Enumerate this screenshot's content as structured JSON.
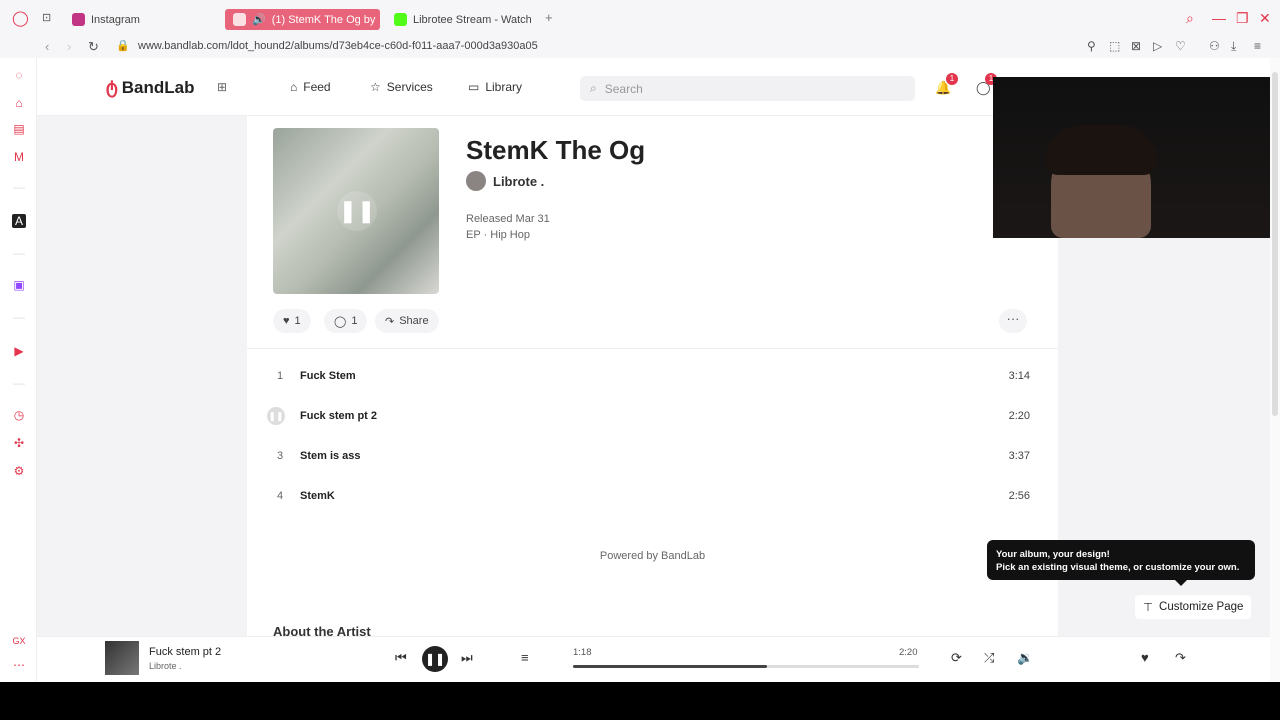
{
  "browser": {
    "tabs": [
      {
        "label": "Instagram",
        "active": false,
        "color": "#c13584"
      },
      {
        "label": "(1) StemK The Og by",
        "active": true,
        "color": "#e3354b"
      },
      {
        "label": "Librotee Stream - Watch",
        "active": false,
        "color": "#53fc18"
      }
    ],
    "url": "www.bandlab.com/ldot_hound2/albums/d73eb4ce-c60d-f011-aaa7-000d3a930a05",
    "new_tab_icon": "plus-icon"
  },
  "header": {
    "logo": "BandLab",
    "nav": [
      {
        "label": "Feed",
        "icon": "home-icon"
      },
      {
        "label": "Services",
        "icon": "star-icon"
      },
      {
        "label": "Library",
        "icon": "library-icon"
      }
    ],
    "search_placeholder": "Search",
    "notification_count": "1",
    "message_count": "1"
  },
  "album": {
    "title": "StemK The Og",
    "artist": "Librote .",
    "released": "Released Mar 31",
    "genre": "EP · Hip Hop",
    "likes": "1",
    "comments": "1",
    "share_label": "Share",
    "more_label": "···"
  },
  "tracks": [
    {
      "num": "1",
      "name": "Fuck Stem",
      "duration": "3:14",
      "playing": false
    },
    {
      "num": "2",
      "name": "Fuck stem pt 2",
      "duration": "2:20",
      "playing": true
    },
    {
      "num": "3",
      "name": "Stem is ass",
      "duration": "3:37",
      "playing": false
    },
    {
      "num": "4",
      "name": "StemK",
      "duration": "2:56",
      "playing": false
    }
  ],
  "powered_by": "Powered by BandLab",
  "about_heading": "About the Artist",
  "tooltip": {
    "line1": "Your album, your design!",
    "line2": "Pick an existing visual theme, or customize your own."
  },
  "customize_label": "Customize Page",
  "player": {
    "title": "Fuck stem pt 2",
    "artist": "Librote .",
    "elapsed": "1:18",
    "total": "2:20",
    "progress": 0.56
  },
  "colors": {
    "accent": "#e3354b",
    "tooltip_bg": "#111111"
  }
}
